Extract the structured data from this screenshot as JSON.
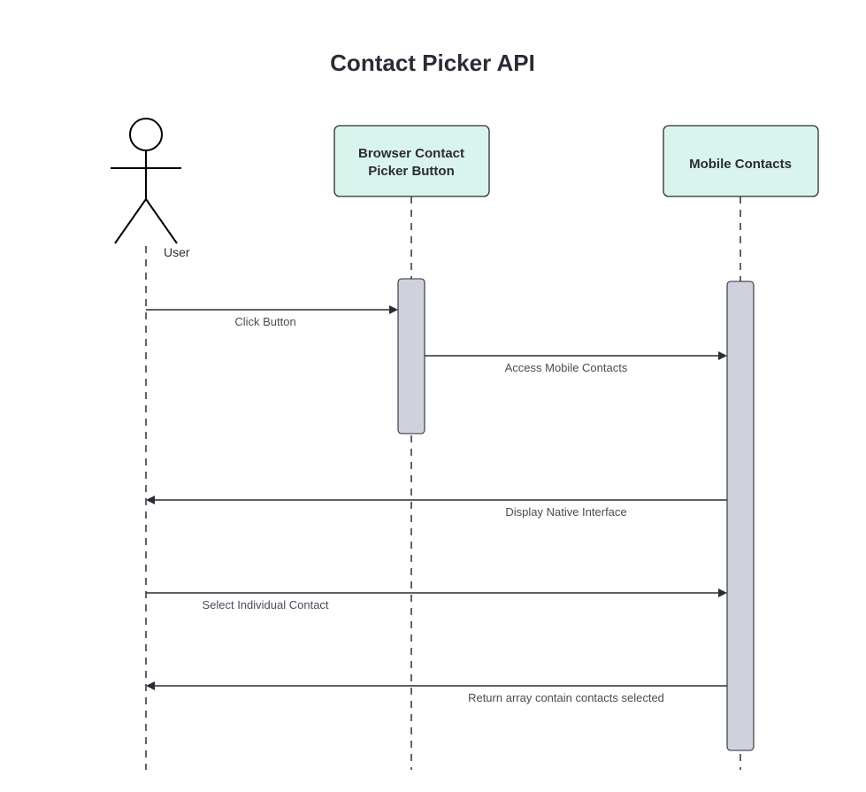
{
  "diagram": {
    "title": "Contact Picker API",
    "actor": {
      "label": "User"
    },
    "participants": {
      "browser": {
        "label_line1": "Browser Contact",
        "label_line2": "Picker Button"
      },
      "mobile": {
        "label": "Mobile Contacts"
      }
    },
    "messages": {
      "m1": "Click Button",
      "m2": "Access Mobile Contacts",
      "m3": "Display Native Interface",
      "m4": "Select Individual Contact",
      "m5": "Return array contain contacts selected"
    }
  },
  "chart_data": {
    "type": "sequence-diagram",
    "title": "Contact Picker API",
    "participants": [
      {
        "id": "user",
        "label": "User",
        "kind": "actor"
      },
      {
        "id": "browser",
        "label": "Browser Contact Picker Button",
        "kind": "object"
      },
      {
        "id": "mobile",
        "label": "Mobile Contacts",
        "kind": "object"
      }
    ],
    "messages": [
      {
        "from": "user",
        "to": "browser",
        "label": "Click Button",
        "style": "sync"
      },
      {
        "from": "browser",
        "to": "mobile",
        "label": "Access Mobile Contacts",
        "style": "sync"
      },
      {
        "from": "mobile",
        "to": "user",
        "label": "Display Native Interface",
        "style": "return"
      },
      {
        "from": "user",
        "to": "mobile",
        "label": "Select Individual Contact",
        "style": "sync"
      },
      {
        "from": "mobile",
        "to": "user",
        "label": "Return array contain contacts selected",
        "style": "return"
      }
    ],
    "activations": [
      {
        "participant": "browser",
        "start_message_index": 0,
        "end_message_index": 1
      },
      {
        "participant": "mobile",
        "start_message_index": 1,
        "end_message_index": 4
      }
    ]
  }
}
